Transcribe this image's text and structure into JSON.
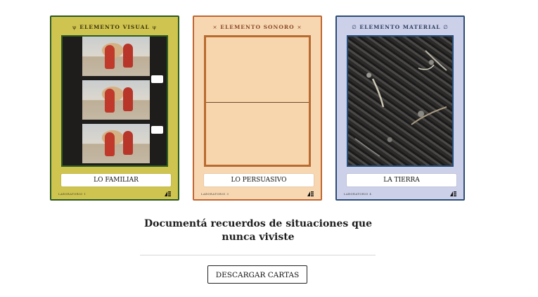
{
  "cards": [
    {
      "header": "ELEMENTO VISUAL",
      "header_glyph": "ψ",
      "label": "LO FAMILIAR",
      "footer": "LABORATORIO 1",
      "color": "#cfc44f",
      "border_color": "#2c5a1d",
      "image": "film-strip-photos"
    },
    {
      "header": "ELEMENTO SONORO",
      "header_glyph": "×",
      "label": "LO PERSUASIVO",
      "footer": "LABORATORIO 3",
      "color": "#f7d7b2",
      "border_color": "#c16630",
      "image": "blank-frame"
    },
    {
      "header": "ELEMENTO MATERIAL",
      "header_glyph": "∅",
      "label": "LA TIERRA",
      "footer": "LABORATORIO 4",
      "color": "#ccd0e8",
      "border_color": "#2b4d78",
      "image": "soil-photo"
    }
  ],
  "tagline": "Documentá recuerdos de situaciones que nunca viviste",
  "download_button": "DESCARGAR CARTAS"
}
